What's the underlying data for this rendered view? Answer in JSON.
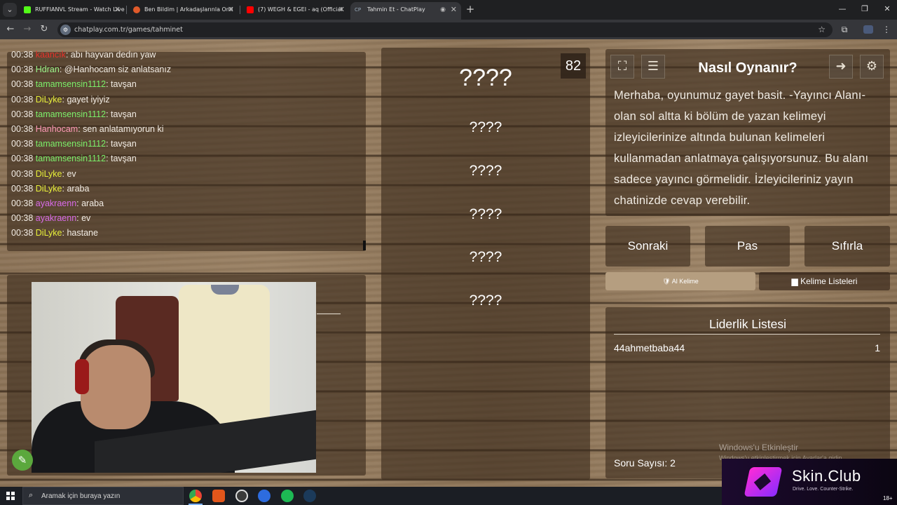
{
  "browser": {
    "tabs": [
      {
        "title": "RUFFIANVL Stream - Watch Live",
        "fav_color": "#53fc18"
      },
      {
        "title": "Ben Bildim | Arkadaşlarınla Onli",
        "fav_color": "#e05a2a"
      },
      {
        "title": "(7) WEGH & EGEI - aq (Official",
        "fav_color": "#ff0000"
      },
      {
        "title": "Tahmin Et - ChatPlay",
        "fav_text": "CP"
      }
    ],
    "url": "chatplay.com.tr/games/tahminet"
  },
  "chat": {
    "messages": [
      {
        "time": "00:38",
        "user": "kaancık",
        "text": ": abı hayvan dedın yaw",
        "color": "#e8322b"
      },
      {
        "time": "00:38",
        "user": "Hdran",
        "text": ": @Hanhocam siz anlatsanız",
        "color": "#9bf58a"
      },
      {
        "time": "00:38",
        "user": "tamamsensin1112",
        "text": ": tavşan",
        "color": "#7cf06a"
      },
      {
        "time": "00:38",
        "user": "DiLyke",
        "text": ": gayet iyiyiz",
        "color": "#e8f03a"
      },
      {
        "time": "00:38",
        "user": "tamamsensin1112",
        "text": ": tavşan",
        "color": "#7cf06a"
      },
      {
        "time": "00:38",
        "user": "Hanhocam",
        "text": ": sen anlatamıyorun ki",
        "color": "#ff9ab8"
      },
      {
        "time": "00:38",
        "user": "tamamsensin1112",
        "text": ": tavşan",
        "color": "#7cf06a"
      },
      {
        "time": "00:38",
        "user": "tamamsensin1112",
        "text": ": tavşan",
        "color": "#7cf06a"
      },
      {
        "time": "00:38",
        "user": "DiLyke",
        "text": ": ev",
        "color": "#e8f03a"
      },
      {
        "time": "00:38",
        "user": "DiLyke",
        "text": ": araba",
        "color": "#e8f03a"
      },
      {
        "time": "00:38",
        "user": "ayakraenn",
        "text": ": araba",
        "color": "#d86ae8"
      },
      {
        "time": "00:38",
        "user": "ayakraenn",
        "text": ": ev",
        "color": "#d86ae8"
      },
      {
        "time": "00:38",
        "user": "DiLyke",
        "text": ": hastane",
        "color": "#e8f03a"
      }
    ]
  },
  "game": {
    "counter": "82",
    "main_word": "????",
    "words": [
      "????",
      "????",
      "????",
      "????",
      "????"
    ]
  },
  "howto": {
    "title": "Nasıl Oynanır?",
    "text": "Merhaba, oyunumuz gayet basit. -Yayıncı Alanı- olan sol altta ki bölüm de yazan kelimeyi izleyicilerinize altında bulunan kelimeleri kullanmadan anlatmaya çalışıyorsunuz. Bu alanı sadece yayıncı görmelidir. İzleyicileriniz yayın chatinizde cevap verebilir."
  },
  "buttons": {
    "next": "Sonraki",
    "pass": "Pas",
    "reset": "Sıfırla",
    "ai_word": "Al Kelime",
    "word_lists": "Kelime Listeleri"
  },
  "leaderboard": {
    "title": "Liderlik Listesi",
    "entries": [
      {
        "name": "44ahmetbaba44",
        "score": "1"
      }
    ],
    "question_count": "Soru Sayısı: 2"
  },
  "watermark": {
    "line1": "Windows'u Etkinleştir",
    "line2": "Windows'u etkinleştirmek için Ayarlar'a gidin."
  },
  "overlay": {
    "name": "Skin.Club",
    "tagline": "Drive. Love. Counter-Strike.",
    "age": "18+"
  },
  "taskbar": {
    "search_placeholder": "Aramak için buraya yazın"
  }
}
